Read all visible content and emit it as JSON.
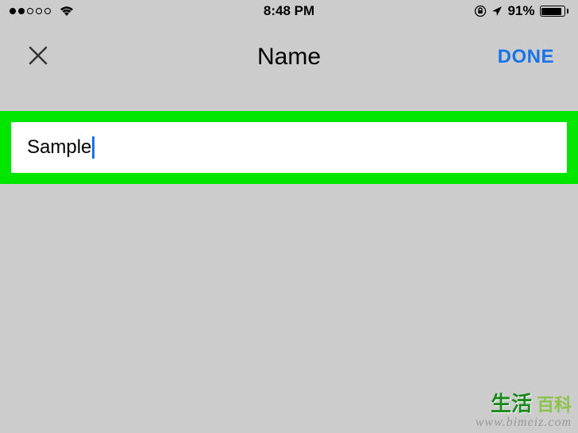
{
  "status_bar": {
    "signal_filled": 2,
    "signal_total": 5,
    "time": "8:48 PM",
    "battery_percent": "91%"
  },
  "nav": {
    "title": "Name",
    "done_label": "DONE"
  },
  "input": {
    "value": "Sample"
  },
  "watermark": {
    "text_main": "生活",
    "text_sub": "百科",
    "url": "www.bimeiz.com"
  }
}
